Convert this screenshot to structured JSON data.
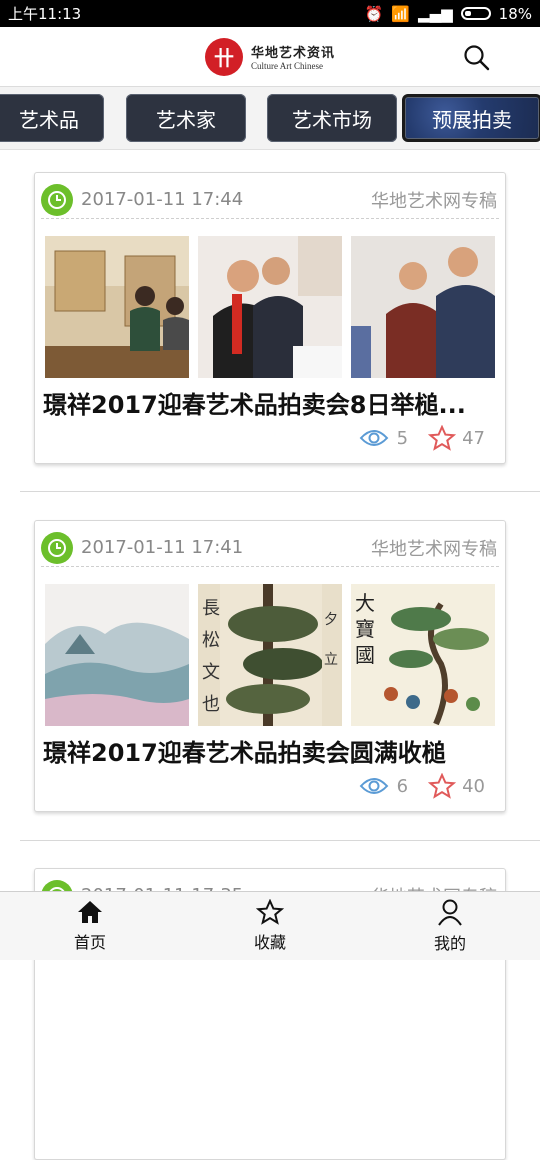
{
  "status_bar": {
    "time": "上午11:13",
    "battery": "18%"
  },
  "header": {
    "logo_cn": "华地艺术资讯",
    "logo_en": "Culture Art Chinese",
    "logo_mark": "HDCAC.COM"
  },
  "tabs": [
    {
      "label": "艺术品"
    },
    {
      "label": "艺术家"
    },
    {
      "label": "艺术市场"
    },
    {
      "label": "预展拍卖",
      "active": true
    }
  ],
  "articles": [
    {
      "date": "2017-01-11 17:44",
      "source": "华地艺术网专稿",
      "title": "璟祥2017迎春艺术品拍卖会8日举槌...",
      "views": "5",
      "favorites": "47"
    },
    {
      "date": "2017-01-11 17:41",
      "source": "华地艺术网专稿",
      "title": "璟祥2017迎春艺术品拍卖会圆满收槌",
      "views": "6",
      "favorites": "40"
    },
    {
      "date": "2017-01-11 17:35",
      "source": "华地艺术网专稿"
    }
  ],
  "bottom_nav": [
    {
      "label": "首页",
      "icon": "home-icon"
    },
    {
      "label": "收藏",
      "icon": "star-icon"
    },
    {
      "label": "我的",
      "icon": "user-icon"
    }
  ],
  "colors": {
    "accent_green": "#6cbf2b",
    "tab_bg": "#2d3340",
    "logo_red": "#d21f26",
    "eye_blue": "#5b9bd5",
    "star_red": "#e05a5a"
  }
}
